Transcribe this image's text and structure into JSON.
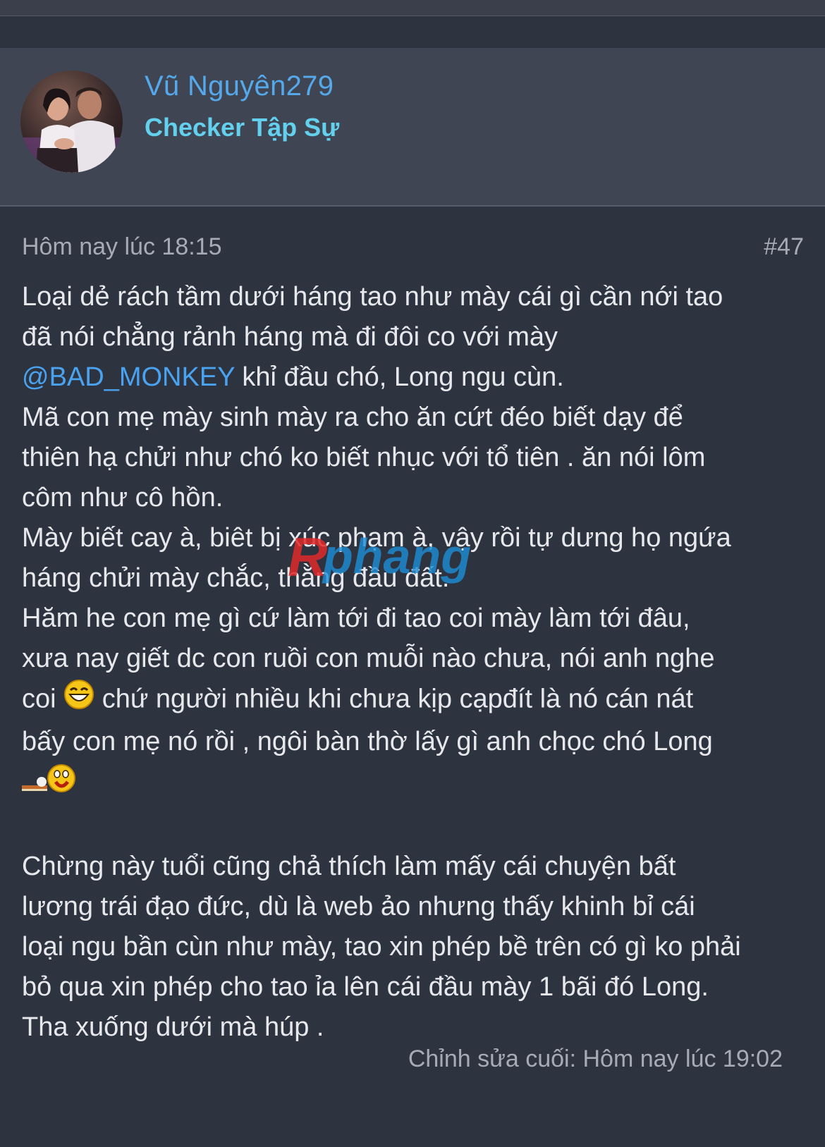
{
  "user": {
    "name": "Vũ Nguyên279",
    "title": "Checker Tập Sự"
  },
  "post": {
    "time": "Hôm nay lúc 18:15",
    "number": "#47",
    "lines": {
      "l1": "Loại dẻ rách tầm dưới háng tao như mày cái gì cần nới tao",
      "l2": "đã nói chẳng rảnh háng mà đi đôi co với mày",
      "mention": "@BAD_MONKEY",
      "l3_rest": " khỉ đầu chó, Long ngu cùn.",
      "l4": "Mã con mẹ mày sinh mày ra cho ăn cứt đéo biết dạy để",
      "l5": "thiên hạ chửi như chó ko biết nhục với tổ tiên . ăn nói lôm",
      "l6": "côm như cô hồn.",
      "l7": "Mày biết cay à, biêt bị xúc phạm à, vậy rồi tự dưng họ ngứa",
      "l8": "háng chửi mày chắc, thằng đầu đất.",
      "l9": "Hăm he con mẹ gì cứ làm tới đi tao coi mày làm tới đâu,",
      "l10": "xưa nay giết dc con ruồi con muỗi nào chưa, nói anh nghe",
      "l11_a": "coi ",
      "l11_b": " chứ người nhiều khi chưa kịp cạpđít là nó cán nát",
      "l12": "bấy con mẹ nó rồi , ngôi bàn thờ lấy gì anh chọc chó Long",
      "l14": "Chừng này tuổi cũng chả thích làm mấy cái chuyện bất",
      "l15": "lương trái đạo đức, dù là web ảo nhưng thấy khinh bỉ cái",
      "l16": "loại ngu bần cùn như mày, tao xin phép bề trên có gì ko phải",
      "l17": "bỏ qua xin phép cho tao ỉa lên cái đầu mày 1 bãi đó Long.",
      "l18": "Tha xuống dưới mà húp ."
    },
    "emojis": [
      "laughing-emoji",
      "smoking-emoji"
    ],
    "watermark": "Rphang",
    "last_edited": "Chỉnh sửa cuối: Hôm nay lúc 19:02"
  },
  "colors": {
    "background": "#2e3340",
    "header_background": "#3f4553",
    "username": "#55a8ea",
    "user_title": "#63d0ee",
    "mention": "#4aa3f0",
    "meta_text": "#a6abb5",
    "body_text": "#e6e8ec"
  }
}
